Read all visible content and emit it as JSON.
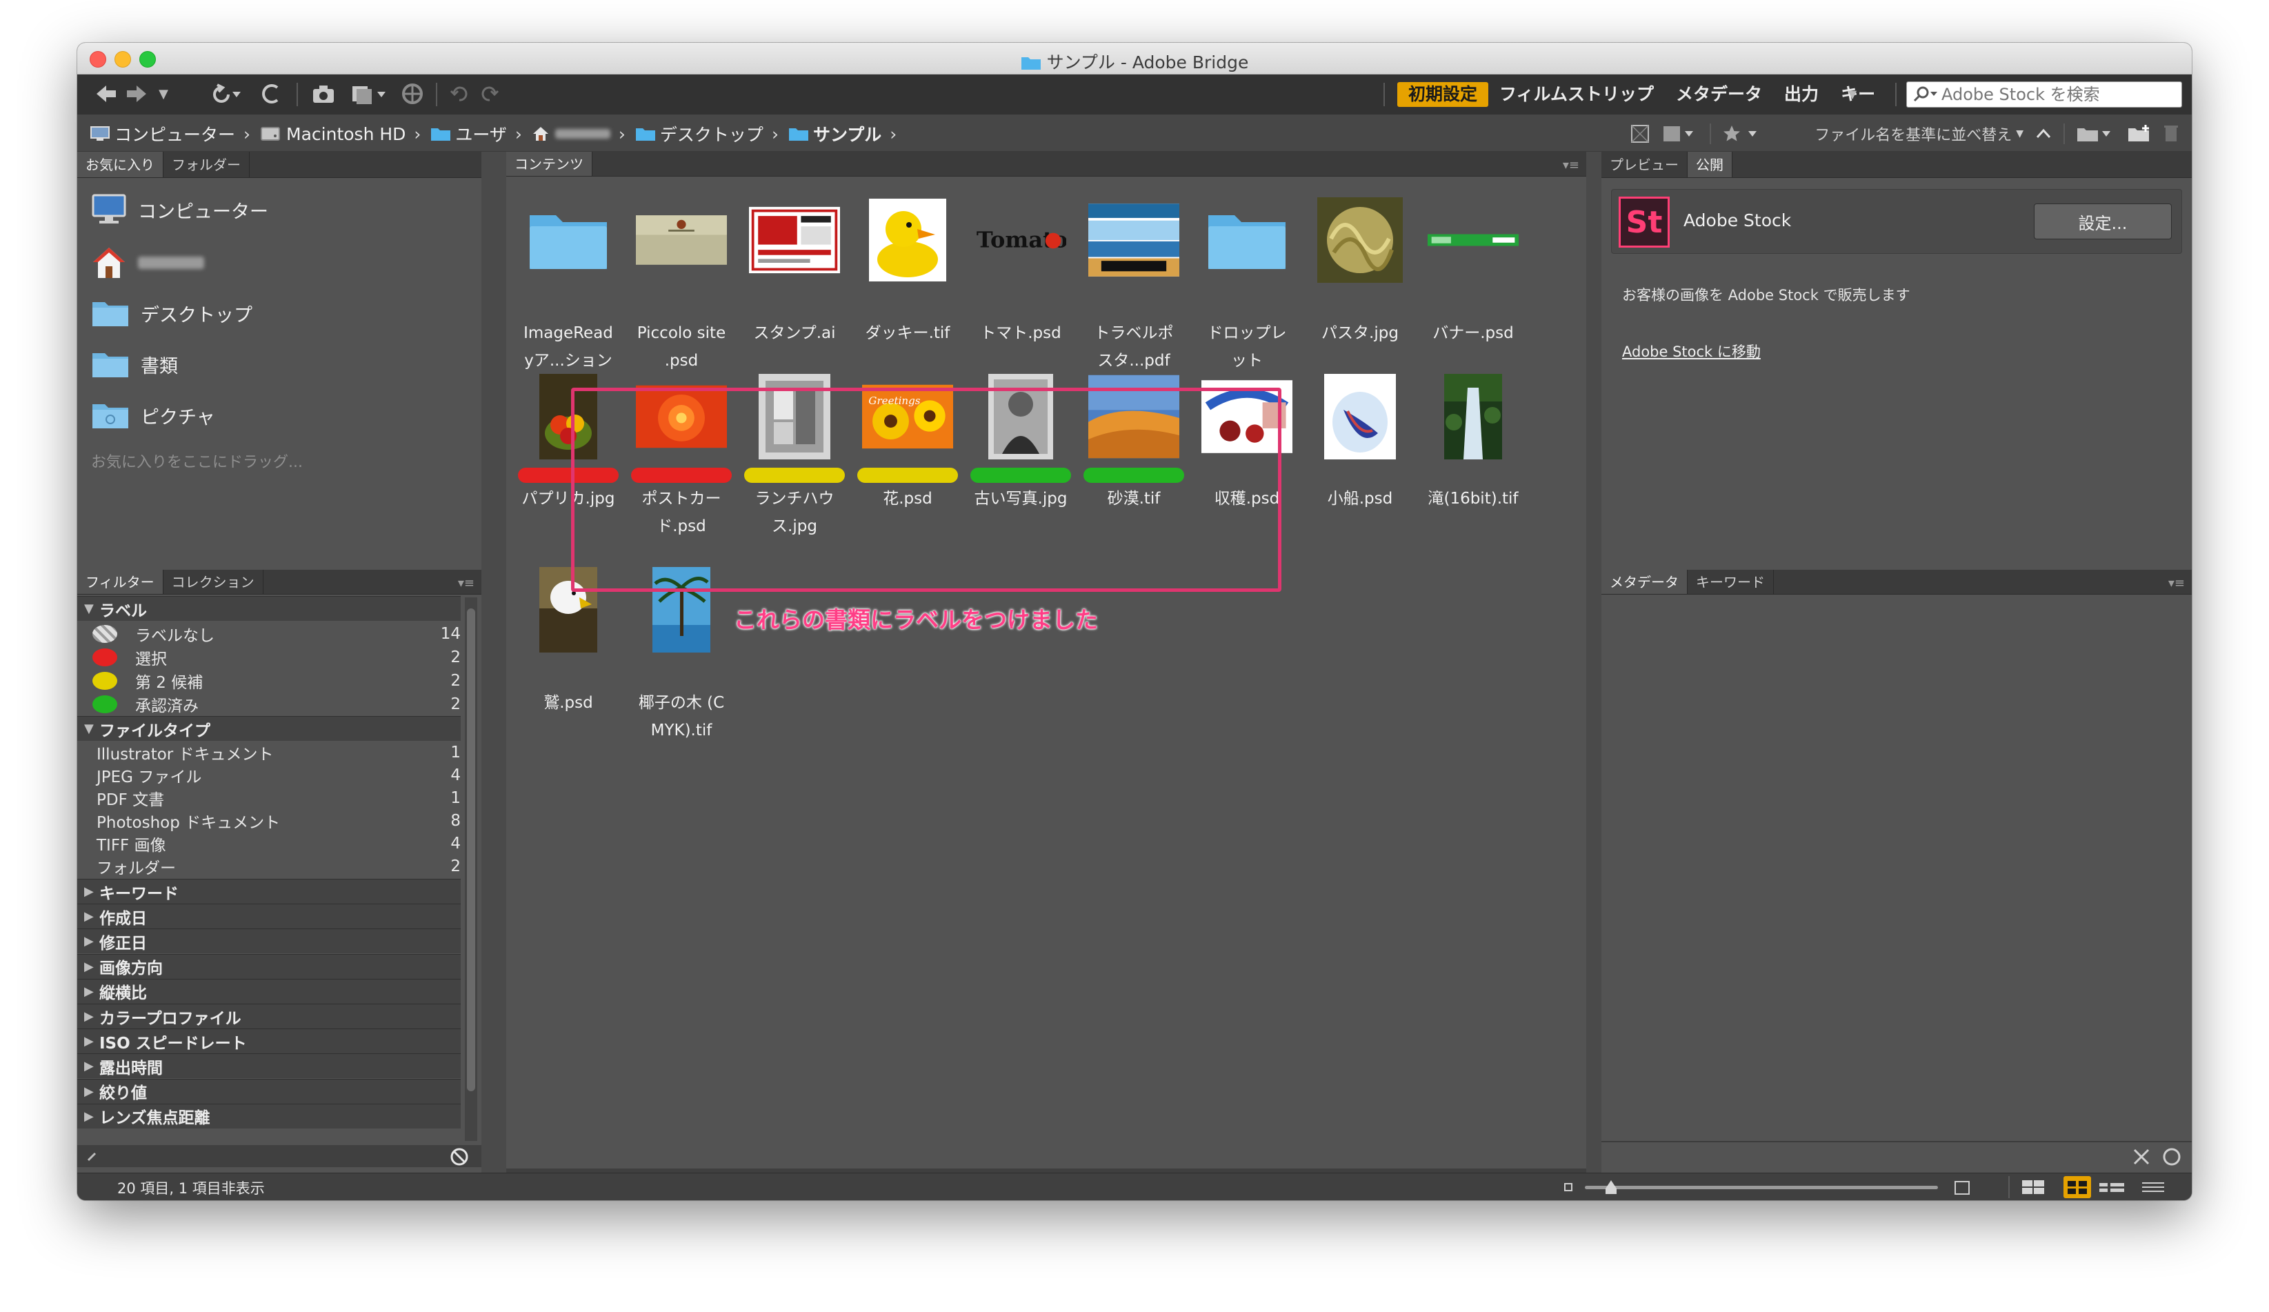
{
  "window": {
    "title": "サンプル - Adobe Bridge"
  },
  "toolbar": {
    "workspaces": [
      "初期設定",
      "フィルムストリップ",
      "メタデータ",
      "出力",
      "キー"
    ],
    "search_placeholder": "Adobe Stock を検索"
  },
  "breadcrumb": {
    "items": [
      "コンピューター",
      "Macintosh HD",
      "ユーザ",
      "",
      "デスクトップ",
      "サンプル"
    ],
    "sort_label": "ファイル名を基準に並べ替え"
  },
  "favorites": {
    "tabs": [
      "お気に入り",
      "フォルダー"
    ],
    "items": [
      "コンピューター",
      "",
      "デスクトップ",
      "書類",
      "ピクチャ"
    ],
    "hint": "お気に入りをここにドラッグ..."
  },
  "filter": {
    "tabs": [
      "フィルター",
      "コレクション"
    ],
    "label_group": "ラベル",
    "labels": [
      {
        "name": "ラベルなし",
        "count": "14",
        "color": "#d8d8d8"
      },
      {
        "name": "選択",
        "count": "2",
        "color": "#e52222"
      },
      {
        "name": "第 2 候補",
        "count": "2",
        "color": "#e3d000"
      },
      {
        "name": "承認済み",
        "count": "2",
        "color": "#22b622"
      }
    ],
    "filetype_group": "ファイルタイプ",
    "filetypes": [
      {
        "name": "Illustrator ドキュメント",
        "count": "1"
      },
      {
        "name": "JPEG ファイル",
        "count": "4"
      },
      {
        "name": "PDF 文書",
        "count": "1"
      },
      {
        "name": "Photoshop ドキュメント",
        "count": "8"
      },
      {
        "name": "TIFF 画像",
        "count": "4"
      },
      {
        "name": "フォルダー",
        "count": "2"
      }
    ],
    "collapsed": [
      "キーワード",
      "作成日",
      "修正日",
      "画像方向",
      "縦横比",
      "カラープロファイル",
      "ISO スピードレート",
      "露出時間",
      "絞り値",
      "レンズ焦点距離"
    ]
  },
  "content": {
    "tab": "コンテンツ",
    "row1": [
      {
        "cap1": "ImageRead",
        "cap2": "yア...ション",
        "kind": "folder"
      },
      {
        "cap1": "Piccolo site",
        "cap2": ".psd",
        "kind": "piccolo"
      },
      {
        "cap1": "スタンプ.ai",
        "cap2": "",
        "kind": "stamp"
      },
      {
        "cap1": "ダッキー.tif",
        "cap2": "",
        "kind": "duck"
      },
      {
        "cap1": "トマト.psd",
        "cap2": "",
        "kind": "tomato"
      },
      {
        "cap1": "トラベルポ",
        "cap2": "スタ...pdf",
        "kind": "travel"
      },
      {
        "cap1": "ドロップレ",
        "cap2": "ット",
        "kind": "folder"
      },
      {
        "cap1": "パスタ.jpg",
        "cap2": "",
        "kind": "pasta"
      },
      {
        "cap1": "バナー.psd",
        "cap2": "",
        "kind": "banner"
      }
    ],
    "row2": [
      {
        "cap1": "パプリカ.jpg",
        "cap2": "",
        "label": "red",
        "kind": "paprika"
      },
      {
        "cap1": "ポストカー",
        "cap2": "ド.psd",
        "label": "red",
        "kind": "postcard"
      },
      {
        "cap1": "ランチハウ",
        "cap2": "ス.jpg",
        "label": "yellow",
        "kind": "lunch"
      },
      {
        "cap1": "花.psd",
        "cap2": "",
        "label": "yellow",
        "kind": "flower"
      },
      {
        "cap1": "古い写真.jpg",
        "cap2": "",
        "label": "green",
        "kind": "oldphoto"
      },
      {
        "cap1": "砂漠.tif",
        "cap2": "",
        "label": "green",
        "kind": "desert"
      },
      {
        "cap1": "収穫.psd",
        "cap2": "",
        "label": "",
        "kind": "harvest"
      },
      {
        "cap1": "小船.psd",
        "cap2": "",
        "label": "",
        "kind": "boat"
      },
      {
        "cap1": "滝(16bit).tif",
        "cap2": "",
        "label": "",
        "kind": "waterfall"
      }
    ],
    "row3": [
      {
        "cap1": "鷲.psd",
        "cap2": "",
        "kind": "eagle"
      },
      {
        "cap1": "椰子の木 (C",
        "cap2": "MYK).tif",
        "kind": "palm"
      }
    ],
    "annotation": "これらの書類にラベルをつけました"
  },
  "preview": {
    "tabs": [
      "プレビュー",
      "公開"
    ]
  },
  "stock": {
    "logo": "St",
    "title": "Adobe Stock",
    "settings_button": "設定...",
    "description": "お客様の画像を Adobe Stock で販売します",
    "link": "Adobe Stock に移動"
  },
  "metadata": {
    "tabs": [
      "メタデータ",
      "キーワード"
    ]
  },
  "status": {
    "text": "20 項目, 1 項目非表示"
  },
  "colors": {
    "accent": "#e6a200",
    "annotation": "#e0356f",
    "label_red": "#e52222",
    "label_yellow": "#e3d000",
    "label_green": "#22b622"
  }
}
